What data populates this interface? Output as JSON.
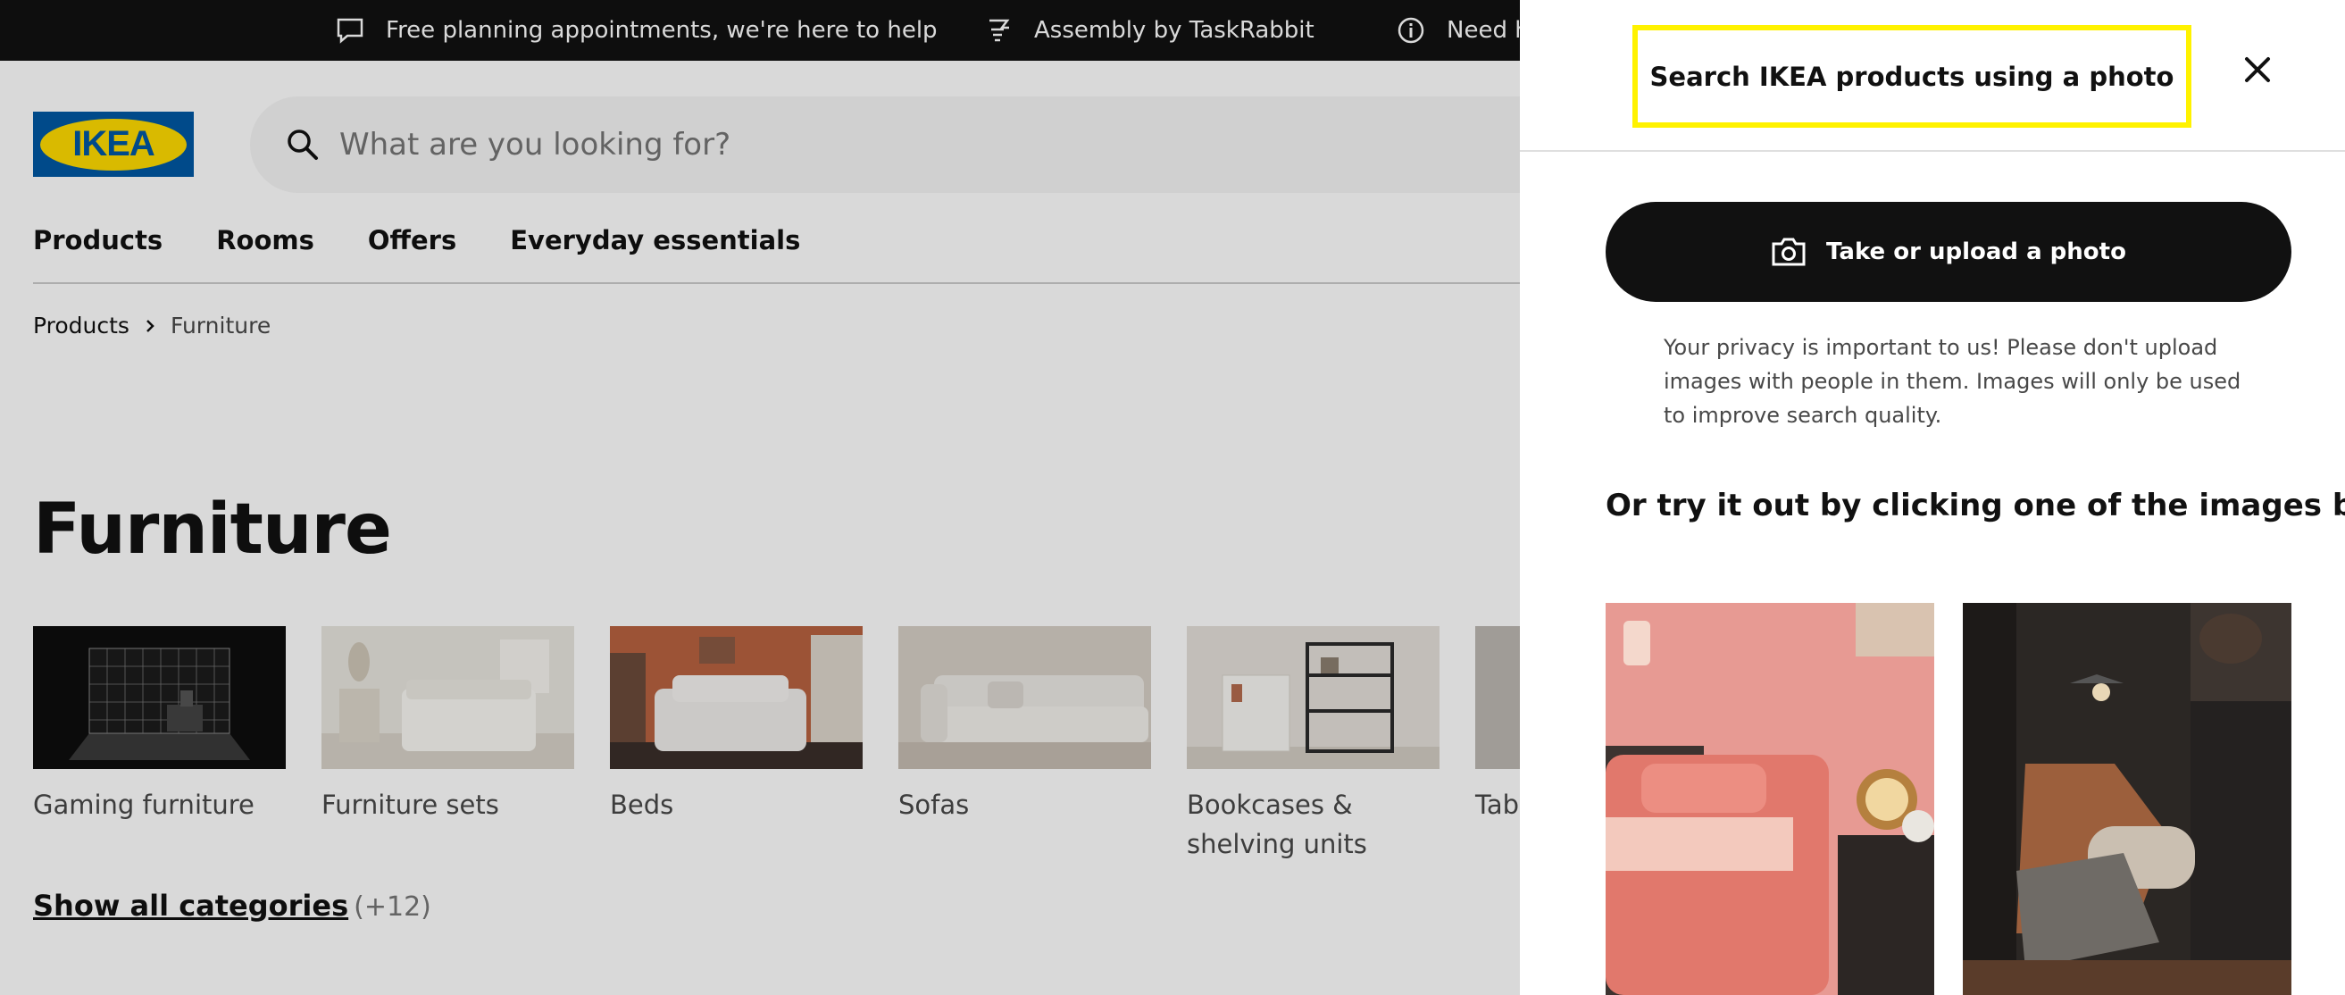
{
  "topbar": {
    "items": [
      {
        "icon": "chat-bubble-icon",
        "label": "Free planning appointments, we're here to help"
      },
      {
        "icon": "assembly-icon",
        "label": "Assembly by TaskRabbit"
      },
      {
        "icon": "info-icon",
        "label": "Need help?"
      }
    ]
  },
  "header": {
    "logo_text": "IKEA",
    "search": {
      "placeholder": "What are you looking for?",
      "value": ""
    }
  },
  "nav": {
    "items": [
      "Products",
      "Rooms",
      "Offers",
      "Everyday essentials"
    ]
  },
  "breadcrumb": {
    "items": [
      "Products",
      "Furniture"
    ]
  },
  "page_title": "Furniture",
  "categories": [
    {
      "label": "Gaming furniture"
    },
    {
      "label": "Furniture sets"
    },
    {
      "label": "Beds"
    },
    {
      "label": "Sofas"
    },
    {
      "label": "Bookcases & shelving units"
    },
    {
      "label": "Tables"
    }
  ],
  "show_all": {
    "label": "Show all categories",
    "count": "(+12)"
  },
  "panel": {
    "title": "Search IKEA products using a photo",
    "upload_label": "Take or upload a photo",
    "privacy_text": "Your privacy is important to us! Please don't upload images with people in them. Images will only be used to improve search quality.",
    "try_text": "Or try it out by clicking one of the images below"
  },
  "colors": {
    "ikea_blue": "#0058a3",
    "ikea_yellow": "#ffdb00",
    "highlight": "#fff200",
    "dark": "#111111"
  }
}
